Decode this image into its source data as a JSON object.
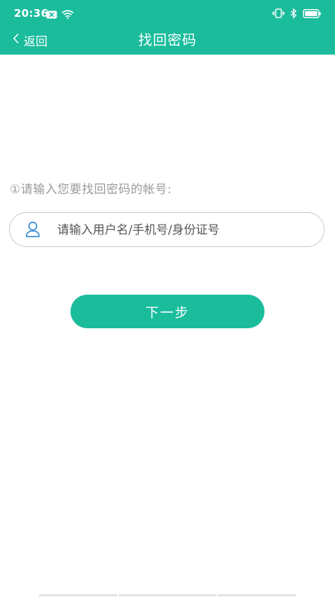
{
  "status_bar": {
    "time": "20:36"
  },
  "header": {
    "back_label": "返回",
    "title": "找回密码"
  },
  "form": {
    "step_label": "①请输入您要找回密码的帐号:",
    "account_placeholder": "请输入用户名/手机号/身份证号",
    "next_button": "下一步"
  },
  "colors": {
    "accent": "#1abc9c",
    "icon_blue": "#3d8fd6"
  }
}
